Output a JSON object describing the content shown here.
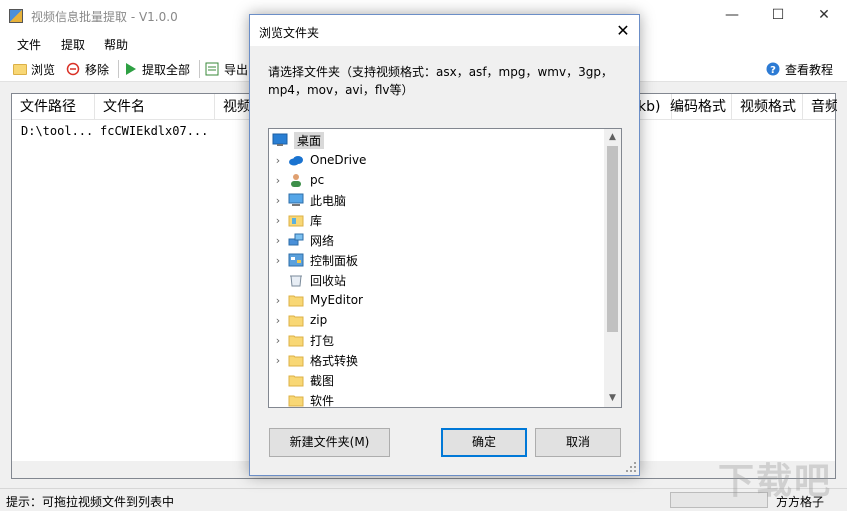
{
  "window": {
    "title": "视频信息批量提取 - V1.0.0",
    "controls": {
      "minimize": "—",
      "maximize": "☐",
      "close": "✕"
    }
  },
  "menu": [
    "文件",
    "提取",
    "帮助"
  ],
  "toolbar": {
    "browse": "浏览",
    "remove": "移除",
    "extract_all": "提取全部",
    "export": "导出",
    "tutorial": "查看教程"
  },
  "list": {
    "columns": [
      "文件路径",
      "文件名",
      "视频",
      "kb)",
      "编码格式",
      "视频格式",
      "音频"
    ],
    "rows": [
      {
        "path": "D:\\tool...",
        "name": "fcCWIEkdlx07..."
      }
    ]
  },
  "status": {
    "hint": "提示：可拖拉视频文件到列表中",
    "right": "方方格子"
  },
  "watermark": "下载吧",
  "dialog": {
    "title": "浏览文件夹",
    "close": "✕",
    "prompt": "请选择文件夹（支持视频格式：asx，asf，mpg，wmv，3gp，mp4，mov，avi，flv等）",
    "tree": [
      {
        "label": "桌面",
        "icon": "desktop-icon",
        "expandable": false,
        "selected": true
      },
      {
        "label": "OneDrive",
        "icon": "cloud-icon",
        "expandable": true
      },
      {
        "label": "pc",
        "icon": "user-icon",
        "expandable": true
      },
      {
        "label": "此电脑",
        "icon": "computer-icon",
        "expandable": true
      },
      {
        "label": "库",
        "icon": "library-icon",
        "expandable": true
      },
      {
        "label": "网络",
        "icon": "network-icon",
        "expandable": true
      },
      {
        "label": "控制面板",
        "icon": "control-panel-icon",
        "expandable": true
      },
      {
        "label": "回收站",
        "icon": "recycle-bin-icon",
        "expandable": false
      },
      {
        "label": "MyEditor",
        "icon": "folder-icon",
        "expandable": true
      },
      {
        "label": "zip",
        "icon": "folder-icon",
        "expandable": true
      },
      {
        "label": "打包",
        "icon": "folder-icon",
        "expandable": true
      },
      {
        "label": "格式转换",
        "icon": "folder-icon",
        "expandable": true
      },
      {
        "label": "截图",
        "icon": "folder-icon",
        "expandable": false
      },
      {
        "label": "软件",
        "icon": "folder-icon",
        "expandable": false
      }
    ],
    "buttons": {
      "new_folder": "新建文件夹(M)",
      "ok": "确定",
      "cancel": "取消"
    }
  },
  "colors": {
    "accent": "#0078d7",
    "folder": "#f8d775",
    "selection": "#d9d9d9"
  }
}
